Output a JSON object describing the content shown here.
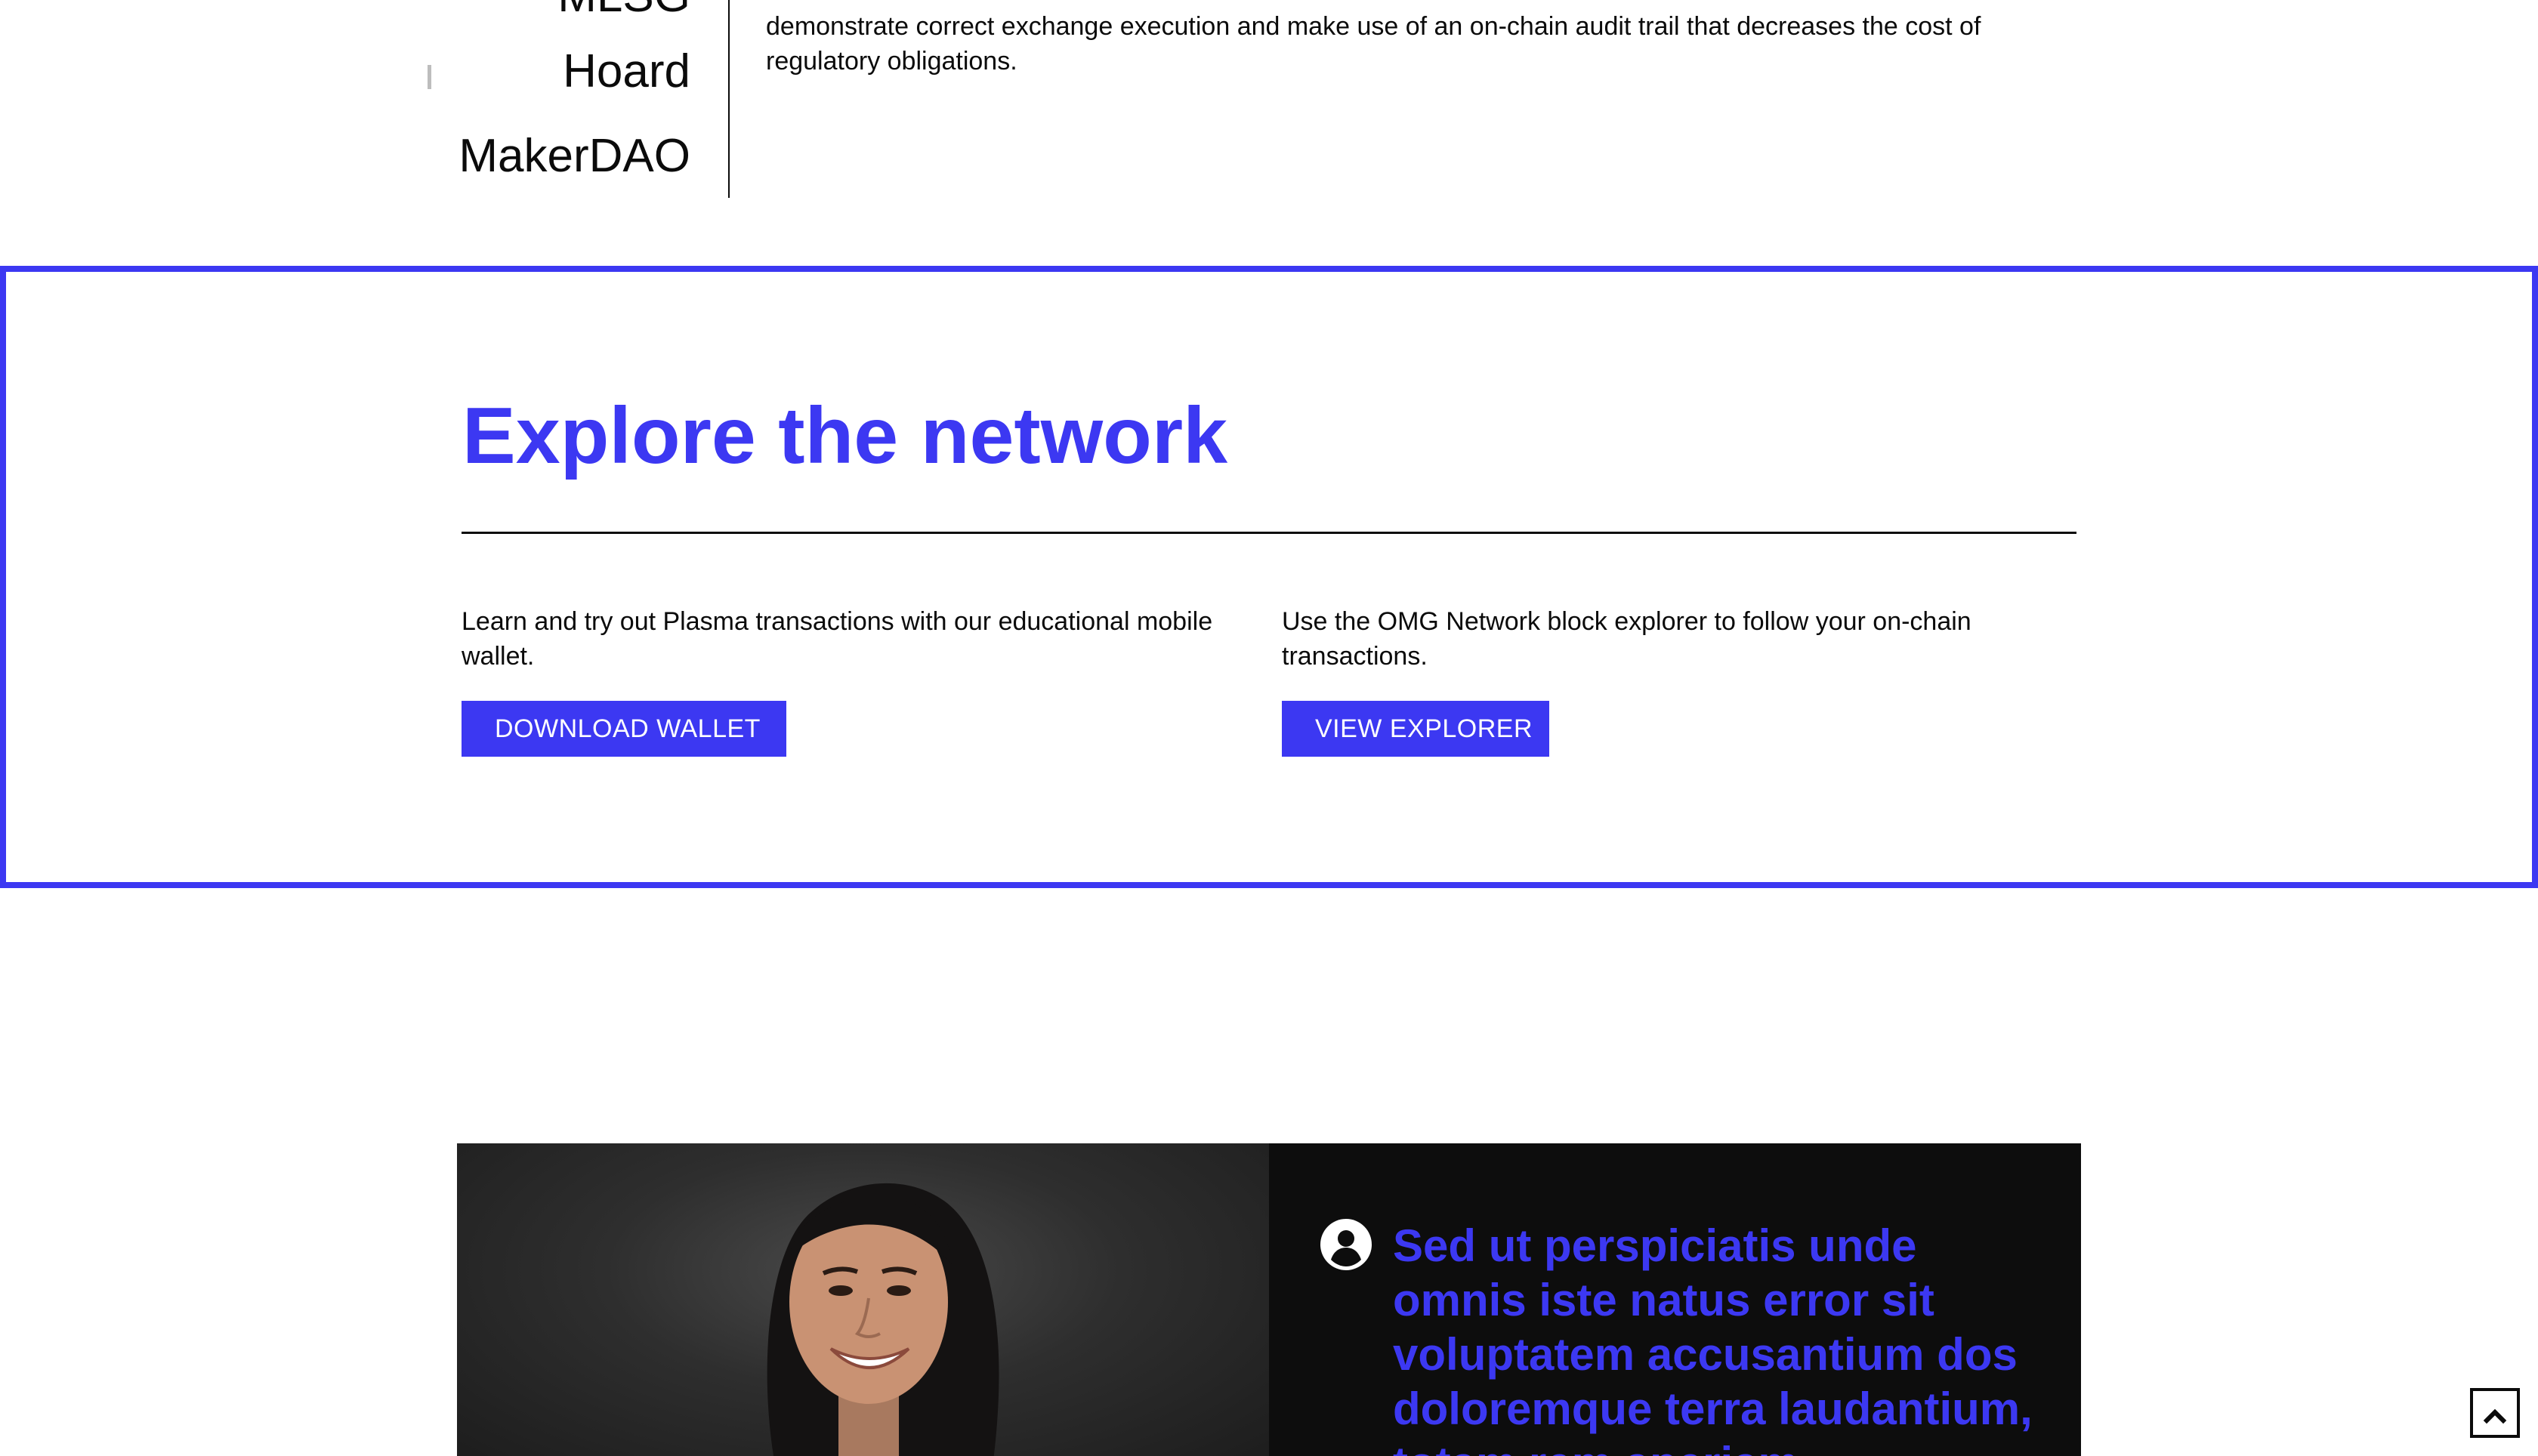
{
  "partners": {
    "items": [
      {
        "label": "MLSG"
      },
      {
        "label": "Hoard"
      },
      {
        "label": "MakerDAO"
      }
    ],
    "description": "demonstrate correct exchange execution and make use of an on-chain audit trail that decreases the cost of regulatory obligations."
  },
  "explore": {
    "title": "Explore the network",
    "wallet_text": "Learn and try out Plasma transactions with our educational mobile wallet.",
    "wallet_button": "DOWNLOAD WALLET",
    "explorer_text": "Use the OMG Network block explorer to follow your on-chain transactions.",
    "explorer_button": "VIEW EXPLORER"
  },
  "testimonial": {
    "icon": "user-circle-icon",
    "quote": "Sed ut perspiciatis unde omnis iste natus error sit voluptatem accusantium dos doloremque terra laudantium, totam rem aperiam"
  },
  "back_to_top": {
    "icon": "chevron-up-icon"
  },
  "colors": {
    "accent": "#3c38f2",
    "text": "#0b0b0b",
    "dark_panel": "#0d0d0d"
  }
}
